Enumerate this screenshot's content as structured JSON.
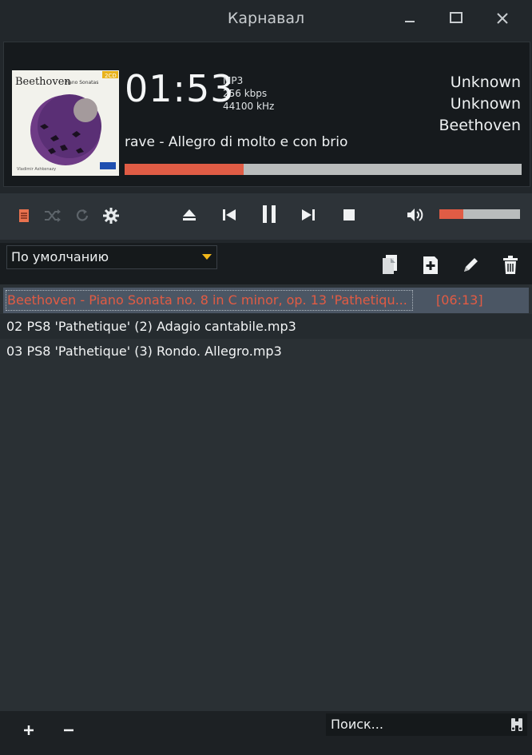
{
  "window": {
    "title": "Карнавал"
  },
  "player": {
    "time": "01:53",
    "format": "MP3",
    "bitrate": "256 kbps",
    "samplerate": "44100 kHz",
    "artist_line1": "Unknown",
    "artist_line2": "Unknown",
    "artist_line3": "Beethoven",
    "track_title": "rave - Allegro di molto e con brio",
    "progress": 0.3,
    "volume": 0.3,
    "album_art_text": "Beethoven",
    "album_art_subtitle": "Piano Sonatas",
    "album_art_badge": "2CD"
  },
  "playlist": {
    "preset": "По умолчанию",
    "items": [
      {
        "title": "Beethoven - Piano Sonata no. 8 in C minor, op. 13 'Pathetiqu...",
        "duration": "[06:13]"
      },
      {
        "title": "02 PS8 'Pathetique' (2) Adagio cantabile.mp3"
      },
      {
        "title": "03 PS8 'Pathetique' (3) Rondo. Allegro.mp3"
      }
    ]
  },
  "search": {
    "placeholder": "Поиск..."
  },
  "colors": {
    "accent": "#e05c45",
    "background": "#22272b",
    "selected_row": "#4b5664"
  },
  "icons": [
    "minimize-icon",
    "maximize-icon",
    "close-icon",
    "playlist-icon",
    "shuffle-icon",
    "repeat-icon",
    "settings-icon",
    "eject-icon",
    "previous-icon",
    "pause-icon",
    "next-icon",
    "stop-icon",
    "volume-icon",
    "copy-icon",
    "add-icon",
    "edit-icon",
    "delete-icon",
    "plus-icon",
    "minus-icon",
    "binoculars-icon"
  ]
}
